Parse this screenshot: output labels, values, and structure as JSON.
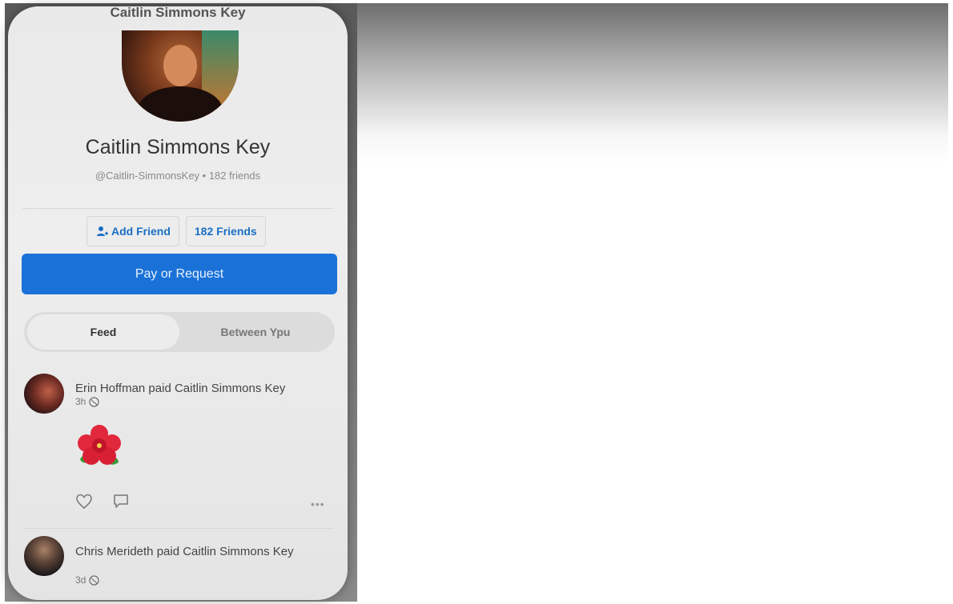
{
  "profile": {
    "header_title": "Caitlin Simmons Key",
    "name": "Caitlin Simmons Key",
    "handle_line": "@Caitlin-SimmonsKey • 182 friends"
  },
  "actions": {
    "add_friend_label": "Add Friend",
    "friends_label": "182 Friends",
    "pay_label": "Pay or Request"
  },
  "tabs": [
    {
      "label": "Feed",
      "active": true
    },
    {
      "label": "Between Ypu",
      "active": false
    }
  ],
  "feed": [
    {
      "text": "Erin Hoffman paid Caitlin Simmons Key",
      "time": "3h",
      "note_icon": "hibiscus-flower-icon"
    },
    {
      "text": "Chris Merideth paid Caitlin Simmons Key",
      "time": "3d"
    }
  ],
  "colors": {
    "accent_blue": "#1a72d8",
    "link_blue": "#1a6fc4"
  }
}
